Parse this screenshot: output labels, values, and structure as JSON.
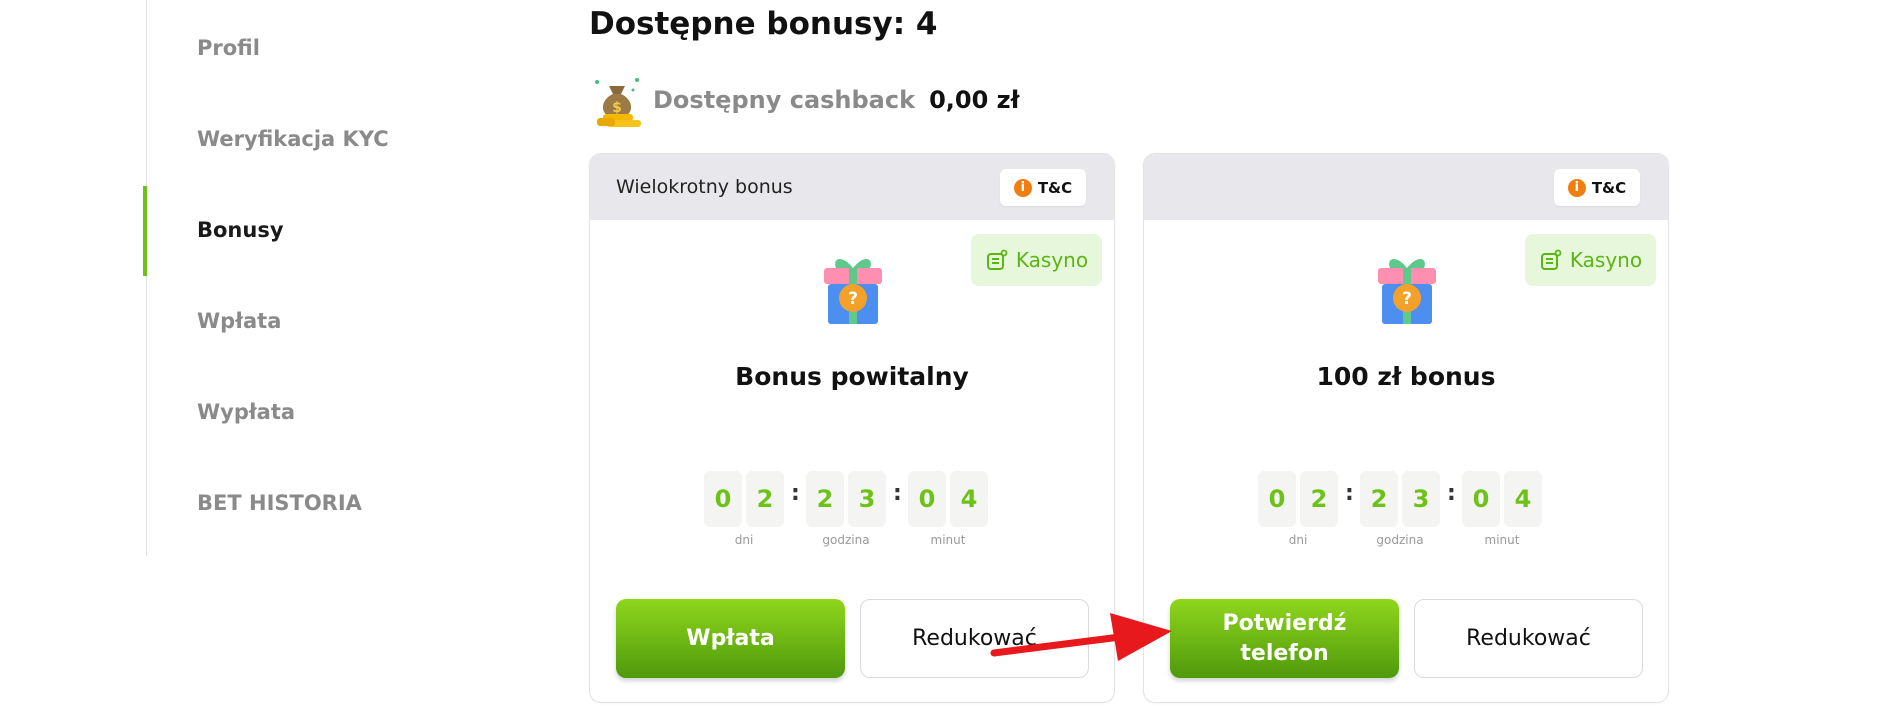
{
  "sidebar": {
    "items": [
      {
        "label": "Profil"
      },
      {
        "label": "Weryfikacja KYC"
      },
      {
        "label": "Bonusy",
        "active": true
      },
      {
        "label": "Wpłata"
      },
      {
        "label": "Wypłata"
      },
      {
        "label": "BET HISTORIA"
      }
    ]
  },
  "header": {
    "title": "Dostępne bonusy: 4",
    "cashback_label": "Dostępny cashback",
    "cashback_value": "0,00 zł"
  },
  "cards": [
    {
      "type_label": "Wielokrotny bonus",
      "tc_label": "T&C",
      "category_badge": "Kasyno",
      "title": "Bonus powitalny",
      "timer": {
        "digits": [
          "0",
          "2",
          "2",
          "3",
          "0",
          "4"
        ],
        "units": [
          "dni",
          "godzina",
          "minut"
        ]
      },
      "primary_button": "Wpłata",
      "secondary_button": "Redukować"
    },
    {
      "type_label": "",
      "tc_label": "T&C",
      "category_badge": "Kasyno",
      "title": "100 zł bonus",
      "timer": {
        "digits": [
          "0",
          "2",
          "2",
          "3",
          "0",
          "4"
        ],
        "units": [
          "dni",
          "godzina",
          "minut"
        ]
      },
      "primary_button": "Potwierdź telefon",
      "secondary_button": "Redukować"
    }
  ],
  "colors": {
    "accent_green": "#6cc217",
    "button_green_top": "#8fd61c",
    "button_green_bottom": "#4f990c",
    "badge_bg": "#e6f7dc",
    "info_orange": "#f07d10",
    "annotation_arrow": "#e8191c"
  },
  "icons": {
    "cashback": "money-bag-coins-icon",
    "gift": "gift-box-question-icon",
    "badge": "casino-chip-icon",
    "tc": "info-icon"
  }
}
